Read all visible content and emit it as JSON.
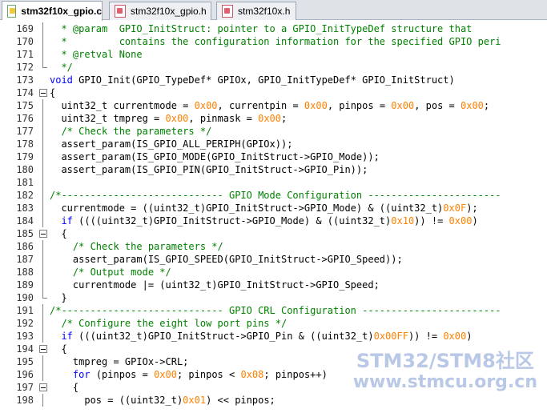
{
  "tabs": [
    {
      "label": "stm32f10x_gpio.c",
      "active": true,
      "kind": "c"
    },
    {
      "label": "stm32f10x_gpio.h",
      "active": false,
      "kind": "h"
    },
    {
      "label": "stm32f10x.h",
      "active": false,
      "kind": "h"
    }
  ],
  "lines": [
    {
      "n": "169",
      "fold": "line",
      "code": "  * @param  GPIO_InitStruct: pointer to a GPIO_InitTypeDef structure that",
      "cls": "t-cm"
    },
    {
      "n": "170",
      "fold": "line",
      "code": "  *         contains the configuration information for the specified GPIO peri",
      "cls": "t-cm"
    },
    {
      "n": "171",
      "fold": "line",
      "code": "  * @retval None",
      "cls": "t-cm"
    },
    {
      "n": "172",
      "fold": "end",
      "code": "  */",
      "cls": "t-cm"
    },
    {
      "n": "173",
      "fold": "",
      "code": "void GPIO_Init(GPIO_TypeDef* GPIOx, GPIO_InitTypeDef* GPIO_InitStruct)",
      "cls": "t-pl"
    },
    {
      "n": "174",
      "fold": "box",
      "code": "{",
      "cls": "t-pl"
    },
    {
      "n": "175",
      "fold": "line",
      "code": "  uint32_t currentmode = 0x00, currentpin = 0x00, pinpos = 0x00, pos = 0x00;",
      "cls": "t-pl"
    },
    {
      "n": "176",
      "fold": "line",
      "code": "  uint32_t tmpreg = 0x00, pinmask = 0x00;",
      "cls": "t-pl"
    },
    {
      "n": "177",
      "fold": "line",
      "code": "  /* Check the parameters */",
      "cls": "t-cm"
    },
    {
      "n": "178",
      "fold": "line",
      "code": "  assert_param(IS_GPIO_ALL_PERIPH(GPIOx));",
      "cls": "t-pl"
    },
    {
      "n": "179",
      "fold": "line",
      "code": "  assert_param(IS_GPIO_MODE(GPIO_InitStruct->GPIO_Mode));",
      "cls": "t-pl"
    },
    {
      "n": "180",
      "fold": "line",
      "code": "  assert_param(IS_GPIO_PIN(GPIO_InitStruct->GPIO_Pin));",
      "cls": "t-pl"
    },
    {
      "n": "181",
      "fold": "line",
      "code": "",
      "cls": "t-pl"
    },
    {
      "n": "182",
      "fold": "line",
      "code": "/*---------------------------- GPIO Mode Configuration -----------------------",
      "cls": "t-cm"
    },
    {
      "n": "183",
      "fold": "line",
      "code": "  currentmode = ((uint32_t)GPIO_InitStruct->GPIO_Mode) & ((uint32_t)0x0F);",
      "cls": "t-pl"
    },
    {
      "n": "184",
      "fold": "line",
      "code": "  if ((((uint32_t)GPIO_InitStruct->GPIO_Mode) & ((uint32_t)0x10)) != 0x00)",
      "cls": "t-pl"
    },
    {
      "n": "185",
      "fold": "box",
      "code": "  {",
      "cls": "t-pl"
    },
    {
      "n": "186",
      "fold": "line",
      "code": "    /* Check the parameters */",
      "cls": "t-cm"
    },
    {
      "n": "187",
      "fold": "line",
      "code": "    assert_param(IS_GPIO_SPEED(GPIO_InitStruct->GPIO_Speed));",
      "cls": "t-pl"
    },
    {
      "n": "188",
      "fold": "line",
      "code": "    /* Output mode */",
      "cls": "t-cm"
    },
    {
      "n": "189",
      "fold": "line",
      "code": "    currentmode |= (uint32_t)GPIO_InitStruct->GPIO_Speed;",
      "cls": "t-pl"
    },
    {
      "n": "190",
      "fold": "end",
      "code": "  }",
      "cls": "t-pl"
    },
    {
      "n": "191",
      "fold": "line",
      "code": "/*---------------------------- GPIO CRL Configuration ------------------------",
      "cls": "t-cm"
    },
    {
      "n": "192",
      "fold": "line",
      "code": "  /* Configure the eight low port pins */",
      "cls": "t-cm"
    },
    {
      "n": "193",
      "fold": "line",
      "code": "  if (((uint32_t)GPIO_InitStruct->GPIO_Pin & ((uint32_t)0x00FF)) != 0x00)",
      "cls": "t-pl"
    },
    {
      "n": "194",
      "fold": "box",
      "code": "  {",
      "cls": "t-pl"
    },
    {
      "n": "195",
      "fold": "line",
      "code": "    tmpreg = GPIOx->CRL;",
      "cls": "t-pl"
    },
    {
      "n": "196",
      "fold": "line",
      "code": "    for (pinpos = 0x00; pinpos < 0x08; pinpos++)",
      "cls": "t-pl"
    },
    {
      "n": "197",
      "fold": "box",
      "code": "    {",
      "cls": "t-pl"
    },
    {
      "n": "198",
      "fold": "line",
      "code": "      pos = ((uint32_t)0x01) << pinpos;",
      "cls": "t-pl"
    }
  ],
  "watermark": {
    "line1": "STM32/STM8社区",
    "line2": "www.stmcu.org.cn"
  },
  "colors": {
    "comment": "#008000",
    "keyword": "#0000ff",
    "number": "#ff8000",
    "text": "#000000"
  }
}
